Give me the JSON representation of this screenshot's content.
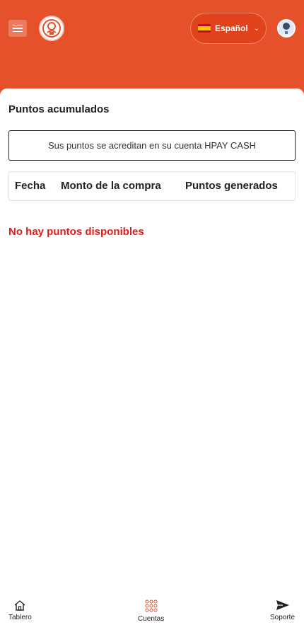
{
  "header": {
    "language": {
      "label": "Español",
      "flag": "spain-flag-icon"
    },
    "colors": {
      "brand": "#e5512a"
    }
  },
  "main": {
    "title": "Puntos acumulados",
    "notice": "Sus puntos se acreditan en su cuenta HPAY CASH",
    "table": {
      "columns": [
        "Fecha",
        "Monto de la compra",
        "Puntos generados"
      ],
      "rows": []
    },
    "empty_message": "No hay puntos disponibles"
  },
  "bottom_nav": {
    "items": [
      {
        "label": "Tablero",
        "icon": "home-icon"
      },
      {
        "label": "Cuentas",
        "icon": "grid-icon"
      },
      {
        "label": "Soporte",
        "icon": "send-icon"
      }
    ]
  }
}
